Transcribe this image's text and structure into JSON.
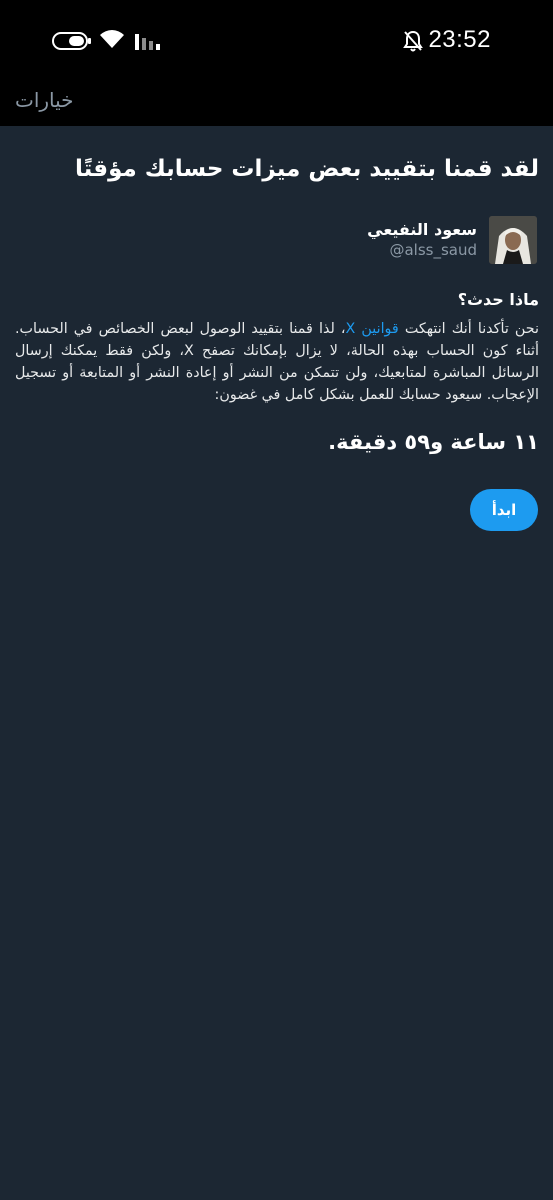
{
  "status_bar": {
    "time": "23:52"
  },
  "nav": {
    "title": "خيارات"
  },
  "main": {
    "headline": "لقد قمنا بتقييد بعض ميزات حسابك مؤقتًا",
    "user": {
      "name": "سعود النفيعي",
      "handle": "@alss_saud"
    },
    "section_title": "ماذا حدث؟",
    "body": {
      "part1": "نحن تأكدنا أنك انتهكت ",
      "link": "قوانين X",
      "part2": "، لذا قمنا بتقييد الوصول لبعض الخصائص في الحساب. أثناء كون الحساب بهذه الحالة، لا يزال بإمكانك تصفح X، ولكن فقط يمكنك إرسال الرسائل المباشرة لمتابعيك، ولن تتمكن من النشر أو إعادة النشر أو المتابعة أو تسجيل الإعجاب. سيعود حسابك للعمل بشكل كامل في غضون:"
    },
    "countdown": "١١ ساعة و٥٩ دقيقة.",
    "start_button": "ابدأ"
  },
  "colors": {
    "background": "#1c2733",
    "bar": "#000000",
    "accent": "#1d9bf0",
    "muted": "#8b98a5"
  },
  "icons": [
    "battery-icon",
    "wifi-icon",
    "signal-icon",
    "mute-bell-icon"
  ]
}
